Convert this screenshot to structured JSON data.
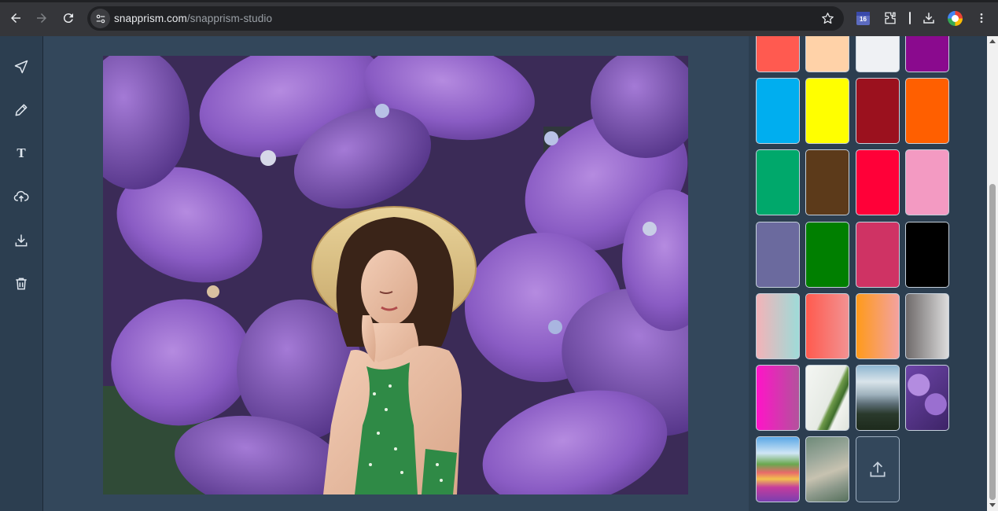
{
  "browser": {
    "back_icon": "arrow-left-icon",
    "forward_icon": "arrow-right-icon",
    "reload_icon": "reload-icon",
    "site_info_icon": "tune-icon",
    "url_host": "snapprism.com",
    "url_path": "/snapprism-studio",
    "bookmark_icon": "star-icon",
    "calendar_badge": "16",
    "extensions_icon": "puzzle-icon",
    "downloads_icon": "download-icon",
    "menu_icon": "more-vert-icon"
  },
  "toolbar": {
    "tools": [
      {
        "name": "select",
        "icon": "navigation-arrow-icon"
      },
      {
        "name": "draw",
        "icon": "pencil-icon"
      },
      {
        "name": "text",
        "icon": "text-icon",
        "label": "T"
      },
      {
        "name": "upload",
        "icon": "cloud-upload-icon"
      },
      {
        "name": "download",
        "icon": "download-icon"
      },
      {
        "name": "delete",
        "icon": "trash-icon"
      }
    ]
  },
  "canvas": {
    "background": "purple hydrangea flowers photo",
    "subject": "woman in straw hat with green floral top"
  },
  "backgrounds_panel": {
    "solid_colors": [
      "#ff5a50",
      "#ffd2a8",
      "#eff1f4",
      "#8a0a8e",
      "#00aeef",
      "#ffff00",
      "#9b111e",
      "#ff5f00",
      "#00a86b",
      "#5c3a1a",
      "#ff0038",
      "#f39ac2",
      "#6b6a9e",
      "#007f00",
      "#cf3364",
      "#000000"
    ],
    "gradients": [
      [
        "#f3b3b8",
        "#9edbd8"
      ],
      [
        "#ff5a4e",
        "#f29292"
      ],
      [
        "#ff9a1a",
        "#f3a2a0"
      ],
      [
        "#6f6a6a",
        "#dcdcdc"
      ],
      [
        "#ff14c8",
        "#b3529c"
      ]
    ],
    "image_thumbnails": [
      "white-fabric-green-leaf",
      "snowy-mountains",
      "purple-hydrangea",
      "flower-field-sky",
      "dry-grass"
    ],
    "upload_icon": "upload-icon"
  }
}
